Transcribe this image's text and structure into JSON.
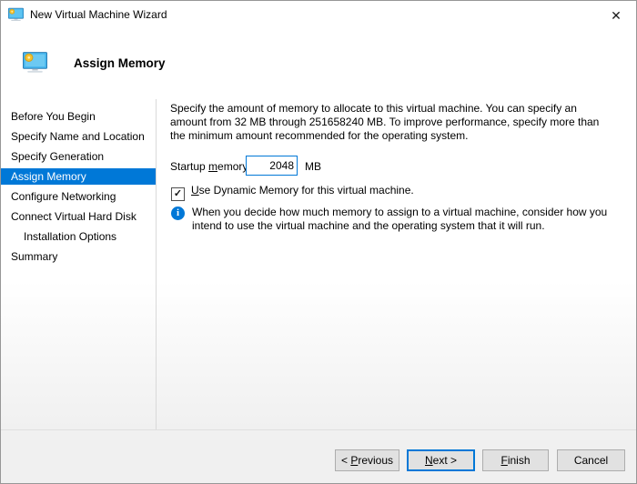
{
  "window": {
    "title": "New Virtual Machine Wizard",
    "close_glyph": "✕"
  },
  "header": {
    "title": "Assign Memory"
  },
  "sidebar": {
    "items": [
      {
        "label": "Before You Begin",
        "selected": false,
        "indent": false
      },
      {
        "label": "Specify Name and Location",
        "selected": false,
        "indent": false
      },
      {
        "label": "Specify Generation",
        "selected": false,
        "indent": false
      },
      {
        "label": "Assign Memory",
        "selected": true,
        "indent": false
      },
      {
        "label": "Configure Networking",
        "selected": false,
        "indent": false
      },
      {
        "label": "Connect Virtual Hard Disk",
        "selected": false,
        "indent": false
      },
      {
        "label": "Installation Options",
        "selected": false,
        "indent": true
      },
      {
        "label": "Summary",
        "selected": false,
        "indent": false
      }
    ]
  },
  "main": {
    "description": "Specify the amount of memory to allocate to this virtual machine. You can specify an amount from 32 MB through 251658240 MB. To improve performance, specify more than the minimum amount recommended for the operating system.",
    "startup_memory": {
      "label_pre": "Startup ",
      "label_key": "m",
      "label_rest": "emory:",
      "value": "2048",
      "unit": "MB"
    },
    "dynamic_memory": {
      "checked": true,
      "check_glyph": "✓",
      "label_key": "U",
      "label_rest": "se Dynamic Memory for this virtual machine."
    },
    "info_note": {
      "icon_glyph": "i",
      "text": "When you decide how much memory to assign to a virtual machine, consider how you intend to use the virtual machine and the operating system that it will run."
    }
  },
  "footer": {
    "buttons": [
      {
        "id": "previous",
        "pre": "< ",
        "key": "P",
        "rest": "revious",
        "default": false
      },
      {
        "id": "next",
        "pre": "",
        "key": "N",
        "rest": "ext >",
        "default": true
      },
      {
        "id": "finish",
        "pre": "",
        "key": "F",
        "rest": "inish",
        "default": false
      },
      {
        "id": "cancel",
        "pre": "Cancel",
        "key": "",
        "rest": "",
        "default": false
      }
    ]
  },
  "colors": {
    "accent": "#0078d7",
    "selected_item_bg": "#0078d7",
    "footer_bg": "#f0f0f0",
    "button_bg": "#e1e1e1",
    "button_border": "#adadad"
  }
}
